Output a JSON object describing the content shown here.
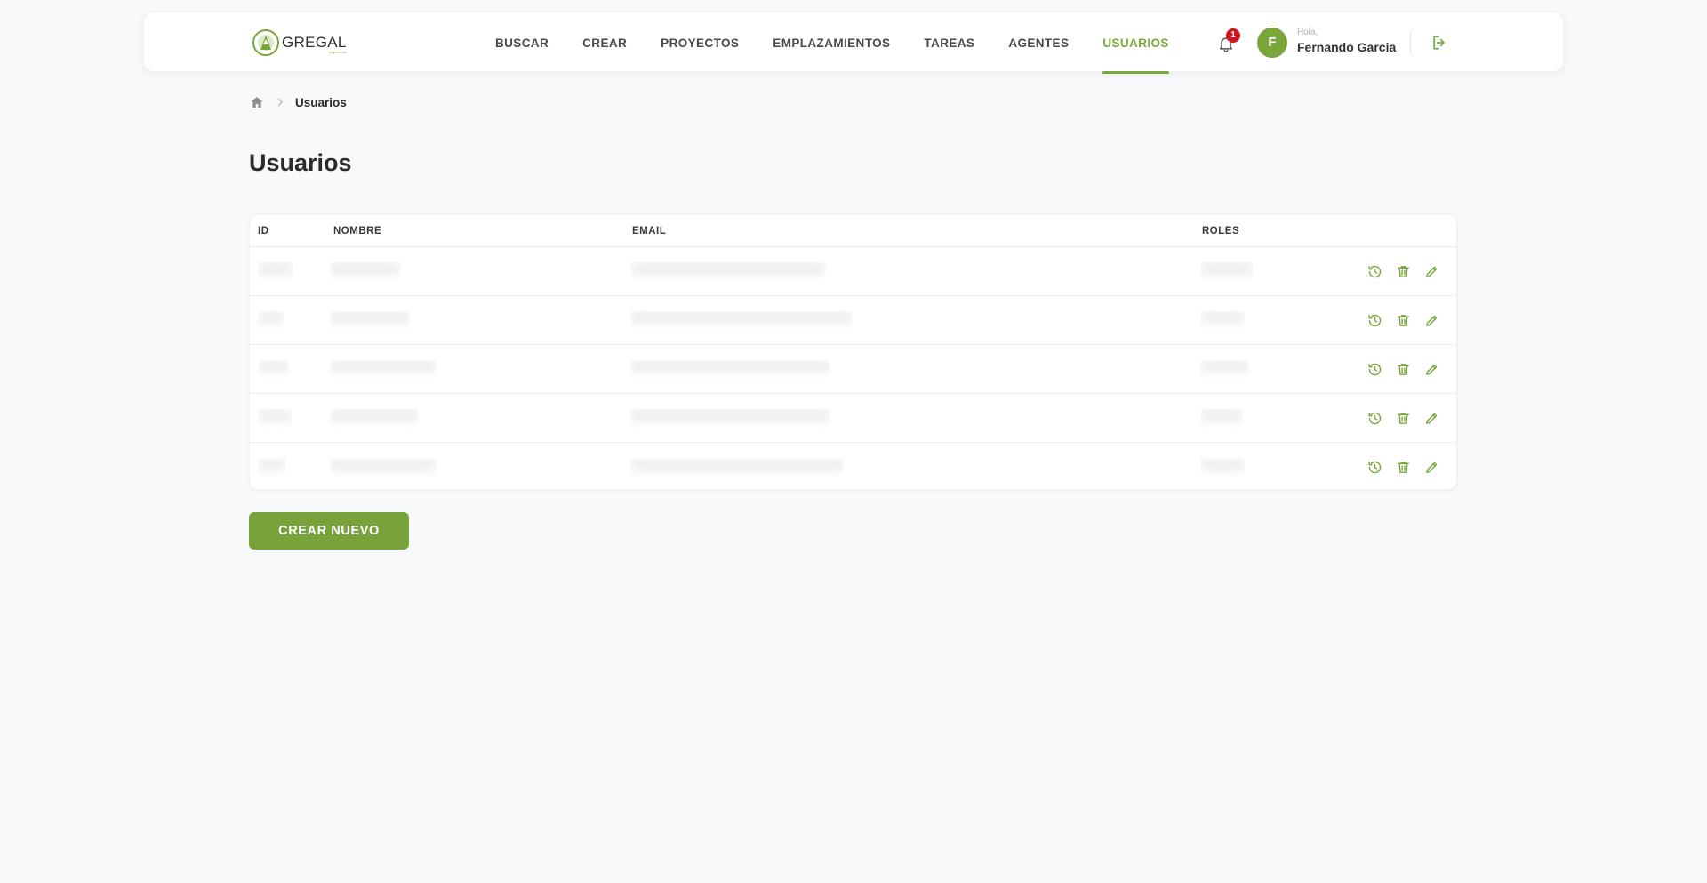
{
  "brand": {
    "name": "GREGAL",
    "subtitle": "ingenieria",
    "accent": "#78a83a"
  },
  "nav": {
    "items": [
      {
        "label": "BUSCAR",
        "active": false
      },
      {
        "label": "CREAR",
        "active": false
      },
      {
        "label": "PROYECTOS",
        "active": false
      },
      {
        "label": "EMPLAZAMIENTOS",
        "active": false
      },
      {
        "label": "TAREAS",
        "active": false
      },
      {
        "label": "AGENTES",
        "active": false
      },
      {
        "label": "USUARIOS",
        "active": true
      }
    ]
  },
  "notifications": {
    "count": "1",
    "icon": "bell-icon",
    "badge_color": "#d0121b"
  },
  "user": {
    "initial": "F",
    "greeting": "Hola,",
    "name": "Fernando Garcia"
  },
  "logout": {
    "icon": "logout-icon"
  },
  "breadcrumb": {
    "home_icon": "home-icon",
    "current": "Usuarios"
  },
  "page": {
    "title": "Usuarios"
  },
  "table": {
    "columns": {
      "id": "ID",
      "nombre": "NOMBRE",
      "email": "EMAIL",
      "roles": "ROLES"
    },
    "rows": [
      {
        "id": "",
        "nombre": "",
        "email": "",
        "roles": ""
      },
      {
        "id": "",
        "nombre": "",
        "email": "",
        "roles": ""
      },
      {
        "id": "",
        "nombre": "",
        "email": "",
        "roles": ""
      },
      {
        "id": "",
        "nombre": "",
        "email": "",
        "roles": ""
      },
      {
        "id": "",
        "nombre": "",
        "email": "",
        "roles": ""
      }
    ],
    "row_actions": [
      "history-icon",
      "trash-icon",
      "pencil-icon"
    ]
  },
  "create_button": {
    "label": "CREAR NUEVO"
  }
}
